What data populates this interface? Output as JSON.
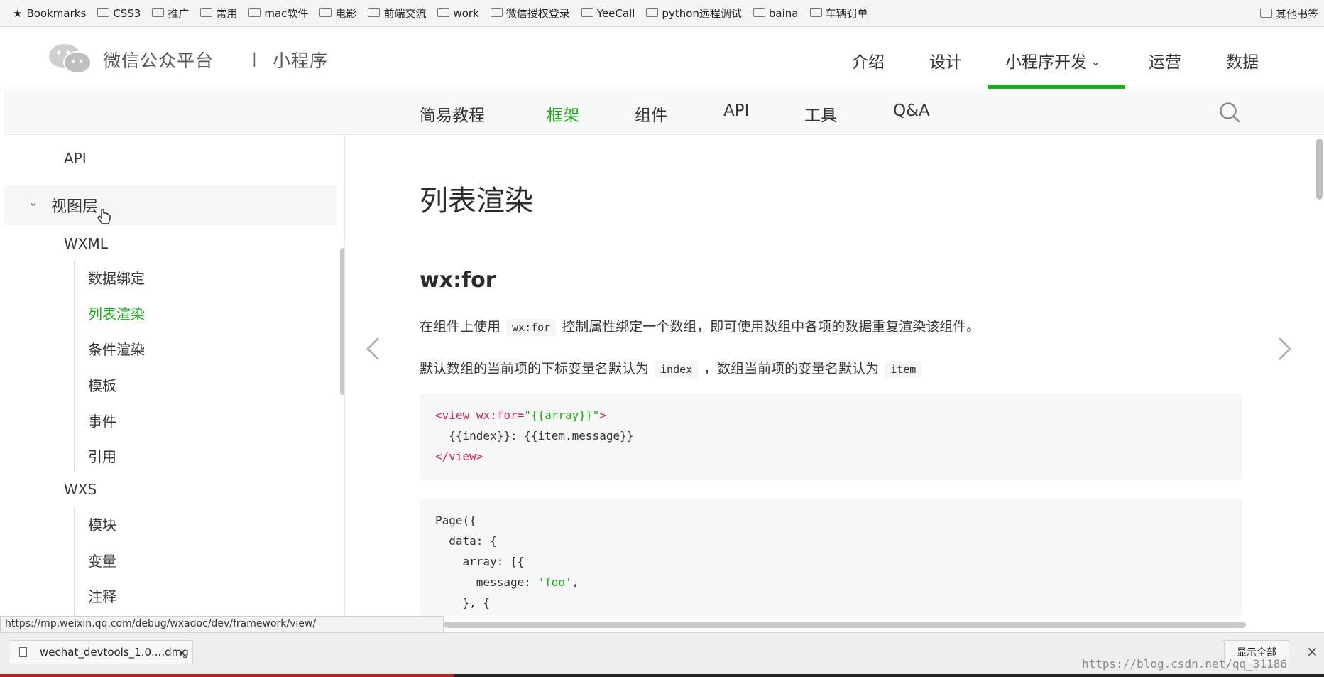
{
  "bookmarks_bar": {
    "items": [
      "Bookmarks",
      "CSS3",
      "推广",
      "常用",
      "mac软件",
      "电影",
      "前端交流",
      "work",
      "微信授权登录",
      "YeeCall",
      "python远程调试",
      "baina",
      "车辆罚单"
    ],
    "other_label": "其他书签"
  },
  "header": {
    "brand": "微信公众平台",
    "separator": "|",
    "product": "小程序",
    "nav": [
      "介绍",
      "设计",
      "小程序开发",
      "运营",
      "数据"
    ],
    "active_nav": "小程序开发"
  },
  "subnav": {
    "items": [
      "简易教程",
      "框架",
      "组件",
      "API",
      "工具",
      "Q&A"
    ],
    "active": "框架"
  },
  "sidebar": {
    "api": "API",
    "view_layer": "视图层",
    "wxml": "WXML",
    "wxml_items": [
      "数据绑定",
      "列表渲染",
      "条件渲染",
      "模板",
      "事件",
      "引用"
    ],
    "wxs": "WXS",
    "wxs_items": [
      "模块",
      "变量",
      "注释"
    ],
    "active_item": "列表渲染"
  },
  "content": {
    "title": "列表渲染",
    "section_heading": "wx:for",
    "para1_before": "在组件上使用",
    "para1_code": "wx:for",
    "para1_after": "控制属性绑定一个数组，即可使用数组中各项的数据重复渲染该组件。",
    "para2_before": "默认数组的当前项的下标变量名默认为",
    "para2_code1": "index",
    "para2_middle": "，数组当前项的变量名默认为",
    "para2_code2": "item",
    "code1": {
      "line1_tag_open": "<view",
      "line1_attr": "wx:for=",
      "line1_str": "\"{{array}}\"",
      "line1_close": ">",
      "line2": "  {{index}}: {{item.message}}",
      "line3": "</view>"
    },
    "code2": {
      "line1": "Page({",
      "line2": "  data: {",
      "line3": "    array: [{",
      "line4_key": "      message: ",
      "line4_str": "'foo'",
      "line4_end": ",",
      "line5": "    }, {"
    }
  },
  "status": {
    "url": "https://mp.weixin.qq.com/debug/wxadoc/dev/framework/view/"
  },
  "downloads": {
    "file": "wechat_devtools_1.0....dmg",
    "show_all": "显示全部",
    "watermark": "https://blog.csdn.net/qq_31186"
  },
  "colors": {
    "accent": "#1aad19",
    "code_tag": "#c7254e"
  }
}
